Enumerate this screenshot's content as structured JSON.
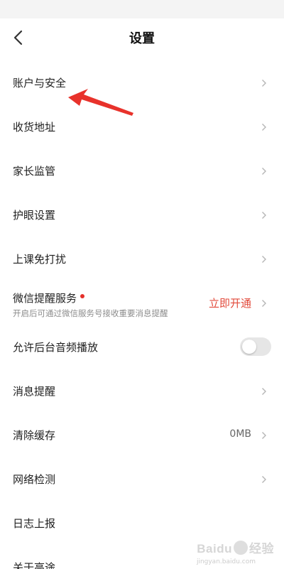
{
  "header": {
    "title": "设置"
  },
  "settings": [
    {
      "label": "账户与安全"
    },
    {
      "label": "收货地址"
    },
    {
      "label": "家长监管"
    },
    {
      "label": "护眼设置"
    },
    {
      "label": "上课免打扰"
    },
    {
      "label": "微信提醒服务",
      "subtitle": "开启后可通过微信服务号接收重要消息提醒",
      "action": "立即开通"
    },
    {
      "label": "允许后台音频播放",
      "toggle_on": false
    },
    {
      "label": "消息提醒"
    },
    {
      "label": "清除缓存",
      "value": "0MB"
    },
    {
      "label": "网络检测"
    },
    {
      "label": "日志上报"
    },
    {
      "label": "关于高途"
    }
  ],
  "annotation_color": "#e8322b",
  "accent_red": "#e24a3b",
  "watermark": {
    "brand": "Baidu",
    "text": "经验",
    "sub": "jingyan.baidu.com"
  }
}
